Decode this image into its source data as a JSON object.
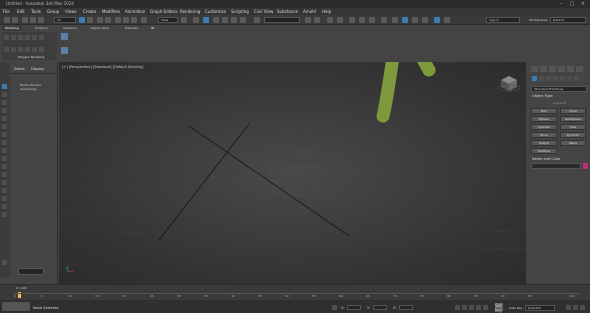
{
  "title": "Untitled - Autodesk 3ds Max 2024",
  "window_controls": {
    "minimize": "–",
    "maximize": "□",
    "close": "×"
  },
  "menus": [
    "File",
    "Edit",
    "Tools",
    "Group",
    "Views",
    "Create",
    "Modifiers",
    "Animation",
    "Graph Editors",
    "Rendering",
    "Customize",
    "Scripting",
    "Civil View",
    "Substance",
    "Arnold",
    "Help"
  ],
  "toolbar": {
    "all_filter": "All",
    "view_dropdown": "View",
    "sign_in": "Sign In",
    "workspaces_label": "Workspaces:",
    "workspaces_value": "Default"
  },
  "ribbon": {
    "tabs": [
      "Modeling",
      "Freeform",
      "Selection",
      "Object Paint",
      "Populate"
    ],
    "panel_label": "Polygon Modeling"
  },
  "scene_explorer": {
    "tabs": [
      "Select",
      "Display"
    ],
    "column_header": "Name (Sorted Ascending)"
  },
  "viewport": {
    "label": "[+] [Perspective] [Standard] [Default Shading]"
  },
  "command_panel": {
    "category_dropdown": "Standard Primitives",
    "object_type_header": "Object Type",
    "autogrid_label": "AutoGrid",
    "object_buttons": [
      "Box",
      "Cone",
      "Sphere",
      "GeoSphere",
      "Cylinder",
      "Tube",
      "Torus",
      "Pyramid",
      "Teapot",
      "Plane",
      "TextPlus"
    ],
    "name_color_header": "Name and Color",
    "accent_color": "#c0307a"
  },
  "timeline": {
    "frame_range": "0 / 100",
    "ticks": [
      "0",
      "5",
      "10",
      "15",
      "20",
      "25",
      "30",
      "35",
      "40",
      "45",
      "50",
      "55",
      "60",
      "65",
      "70",
      "75",
      "80",
      "85",
      "90",
      "95",
      "100"
    ]
  },
  "status": {
    "selection_text": "None Selected",
    "x_label": "X:",
    "y_label": "Y:",
    "z_label": "Z:",
    "autokey_label": "Auto Key",
    "selected_label": "Selected",
    "setkey_label": "Set Key"
  },
  "annotation": {
    "arrow_color": "#7f9a3c"
  }
}
